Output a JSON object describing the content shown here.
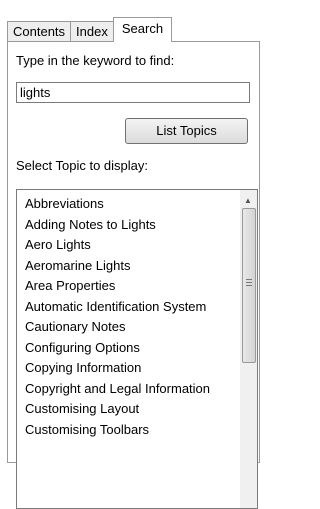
{
  "tabs": [
    {
      "label": "Contents"
    },
    {
      "label": "Index"
    },
    {
      "label": "Search"
    }
  ],
  "search": {
    "prompt": "Type in the keyword to find:",
    "keyword": "lights",
    "list_button": "List Topics",
    "select_label": "Select Topic to display:"
  },
  "topics": [
    "Abbreviations",
    "Adding Notes to Lights",
    "Aero Lights",
    "Aeromarine Lights",
    "Area Properties",
    "Automatic Identification System",
    "Cautionary Notes",
    "Configuring Options",
    "Copying Information",
    "Copyright and Legal Information",
    "Customising Layout",
    "Customising Toolbars"
  ]
}
